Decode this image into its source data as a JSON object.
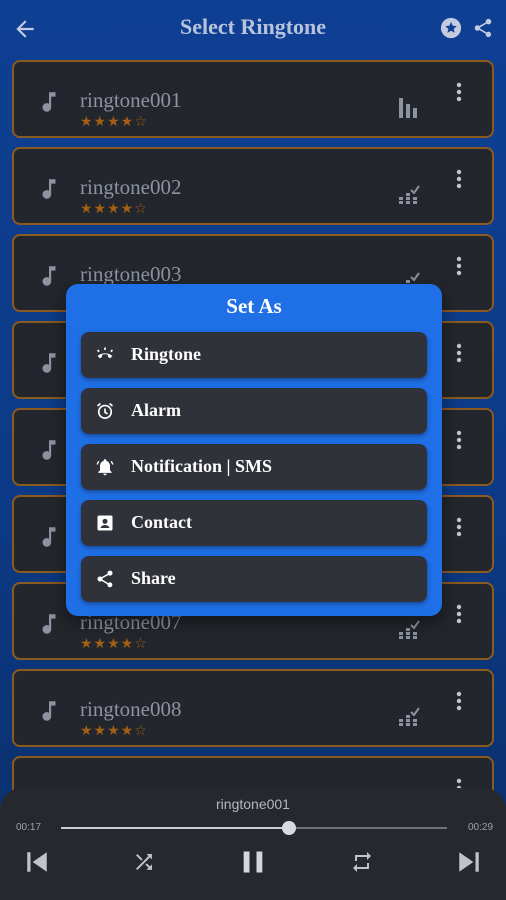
{
  "header": {
    "title": "Select Ringtone"
  },
  "list": {
    "items": [
      {
        "name": "ringtone001",
        "rating": "★★★★☆",
        "eq": "bars"
      },
      {
        "name": "ringtone002",
        "rating": "★★★★☆",
        "eq": "equalizer"
      },
      {
        "name": "ringtone003",
        "rating": "",
        "eq": "equalizer"
      },
      {
        "name": "",
        "rating": "",
        "eq": ""
      },
      {
        "name": "",
        "rating": "",
        "eq": ""
      },
      {
        "name": "",
        "rating": "",
        "eq": ""
      },
      {
        "name": "ringtone007",
        "rating": "★★★★☆",
        "eq": "equalizer"
      },
      {
        "name": "ringtone008",
        "rating": "★★★★☆",
        "eq": "equalizer"
      }
    ]
  },
  "dialog": {
    "title": "Set As",
    "options": [
      {
        "label": "Ringtone",
        "icon": "ringtone-icon"
      },
      {
        "label": "Alarm",
        "icon": "alarm-icon"
      },
      {
        "label": "Notification | SMS",
        "icon": "bell-icon"
      },
      {
        "label": "Contact",
        "icon": "contact-icon"
      },
      {
        "label": "Share",
        "icon": "share-icon"
      }
    ]
  },
  "player": {
    "title": "ringtone001",
    "current_time": "00:17",
    "end_time": "00:29",
    "progress": 0.59
  },
  "colors": {
    "accent": "#1f6fe6",
    "row_border": "#8b5a1f",
    "star": "#a35f13"
  }
}
